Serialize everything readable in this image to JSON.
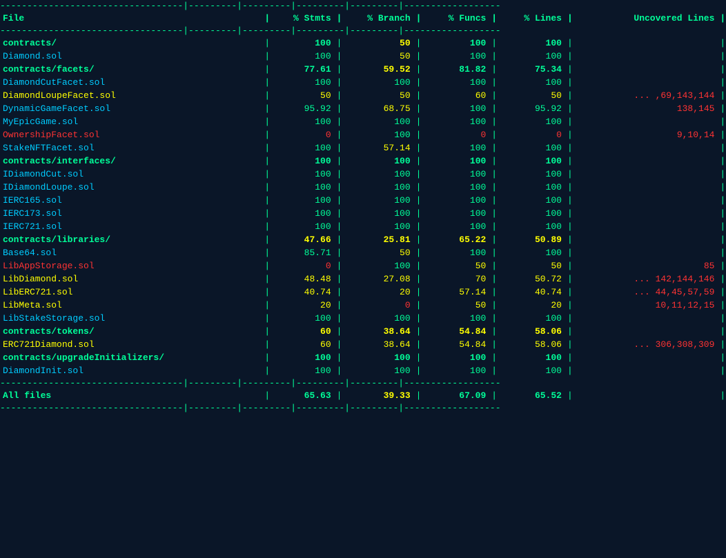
{
  "colors": {
    "bg": "#0a1628",
    "green": "#00ff99",
    "yellow": "#ffff00",
    "red": "#ff3333",
    "cyan": "#00ccff"
  },
  "header": {
    "file": "File",
    "stmts": "% Stmts",
    "branch": "% Branch",
    "funcs": "% Funcs",
    "lines": "% Lines",
    "uncovered": "Uncovered Lines"
  },
  "rows": [
    {
      "file": "contracts/",
      "type": "folder",
      "stmts": "100",
      "branch": "50",
      "funcs": "100",
      "lines": "100",
      "uncovered": ""
    },
    {
      "file": "Diamond.sol",
      "type": "file-normal",
      "stmts": "100",
      "branch": "50",
      "funcs": "100",
      "lines": "100",
      "uncovered": ""
    },
    {
      "file": "contracts/facets/",
      "type": "folder",
      "stmts": "77.61",
      "branch": "59.52",
      "funcs": "81.82",
      "lines": "75.34",
      "uncovered": ""
    },
    {
      "file": "DiamondCutFacet.sol",
      "type": "file-normal",
      "stmts": "100",
      "branch": "100",
      "funcs": "100",
      "lines": "100",
      "uncovered": ""
    },
    {
      "file": "DiamondLoupeFacet.sol",
      "type": "file-warn",
      "stmts": "50",
      "branch": "50",
      "funcs": "60",
      "lines": "50",
      "uncovered": "... ,69,143,144"
    },
    {
      "file": "DynamicGameFacet.sol",
      "type": "file-normal",
      "stmts": "95.92",
      "branch": "68.75",
      "funcs": "100",
      "lines": "95.92",
      "uncovered": "138,145"
    },
    {
      "file": "MyEpicGame.sol",
      "type": "file-normal",
      "stmts": "100",
      "branch": "100",
      "funcs": "100",
      "lines": "100",
      "uncovered": ""
    },
    {
      "file": "OwnershipFacet.sol",
      "type": "file-error",
      "stmts": "0",
      "branch": "100",
      "funcs": "0",
      "lines": "0",
      "uncovered": "9,10,14"
    },
    {
      "file": "StakeNFTFacet.sol",
      "type": "file-normal",
      "stmts": "100",
      "branch": "57.14",
      "funcs": "100",
      "lines": "100",
      "uncovered": ""
    },
    {
      "file": "contracts/interfaces/",
      "type": "folder",
      "stmts": "100",
      "branch": "100",
      "funcs": "100",
      "lines": "100",
      "uncovered": ""
    },
    {
      "file": "IDiamondCut.sol",
      "type": "file-normal",
      "stmts": "100",
      "branch": "100",
      "funcs": "100",
      "lines": "100",
      "uncovered": ""
    },
    {
      "file": "IDiamondLoupe.sol",
      "type": "file-normal",
      "stmts": "100",
      "branch": "100",
      "funcs": "100",
      "lines": "100",
      "uncovered": ""
    },
    {
      "file": "IERC165.sol",
      "type": "file-normal",
      "stmts": "100",
      "branch": "100",
      "funcs": "100",
      "lines": "100",
      "uncovered": ""
    },
    {
      "file": "IERC173.sol",
      "type": "file-normal",
      "stmts": "100",
      "branch": "100",
      "funcs": "100",
      "lines": "100",
      "uncovered": ""
    },
    {
      "file": "IERC721.sol",
      "type": "file-normal",
      "stmts": "100",
      "branch": "100",
      "funcs": "100",
      "lines": "100",
      "uncovered": ""
    },
    {
      "file": "contracts/libraries/",
      "type": "folder",
      "stmts": "47.66",
      "branch": "25.81",
      "funcs": "65.22",
      "lines": "50.89",
      "uncovered": ""
    },
    {
      "file": "Base64.sol",
      "type": "file-normal",
      "stmts": "85.71",
      "branch": "50",
      "funcs": "100",
      "lines": "100",
      "uncovered": ""
    },
    {
      "file": "LibAppStorage.sol",
      "type": "file-error",
      "stmts": "0",
      "branch": "100",
      "funcs": "50",
      "lines": "50",
      "uncovered": "85"
    },
    {
      "file": "LibDiamond.sol",
      "type": "file-warn",
      "stmts": "48.48",
      "branch": "27.08",
      "funcs": "70",
      "lines": "50.72",
      "uncovered": "... 142,144,146"
    },
    {
      "file": "LibERC721.sol",
      "type": "file-warn",
      "stmts": "40.74",
      "branch": "20",
      "funcs": "57.14",
      "lines": "40.74",
      "uncovered": "... 44,45,57,59"
    },
    {
      "file": "LibMeta.sol",
      "type": "file-warn",
      "stmts": "20",
      "branch": "0",
      "funcs": "50",
      "lines": "20",
      "uncovered": "10,11,12,15"
    },
    {
      "file": "LibStakeStorage.sol",
      "type": "file-normal",
      "stmts": "100",
      "branch": "100",
      "funcs": "100",
      "lines": "100",
      "uncovered": ""
    },
    {
      "file": "contracts/tokens/",
      "type": "folder",
      "stmts": "60",
      "branch": "38.64",
      "funcs": "54.84",
      "lines": "58.06",
      "uncovered": ""
    },
    {
      "file": "ERC721Diamond.sol",
      "type": "file-warn",
      "stmts": "60",
      "branch": "38.64",
      "funcs": "54.84",
      "lines": "58.06",
      "uncovered": "... 306,308,309"
    },
    {
      "file": "contracts/upgradeInitializers/",
      "type": "folder",
      "stmts": "100",
      "branch": "100",
      "funcs": "100",
      "lines": "100",
      "uncovered": ""
    },
    {
      "file": "DiamondInit.sol",
      "type": "file-normal",
      "stmts": "100",
      "branch": "100",
      "funcs": "100",
      "lines": "100",
      "uncovered": ""
    }
  ],
  "footer": {
    "label": "All files",
    "stmts": "65.63",
    "branch": "39.33",
    "funcs": "67.09",
    "lines": "65.52",
    "uncovered": ""
  }
}
